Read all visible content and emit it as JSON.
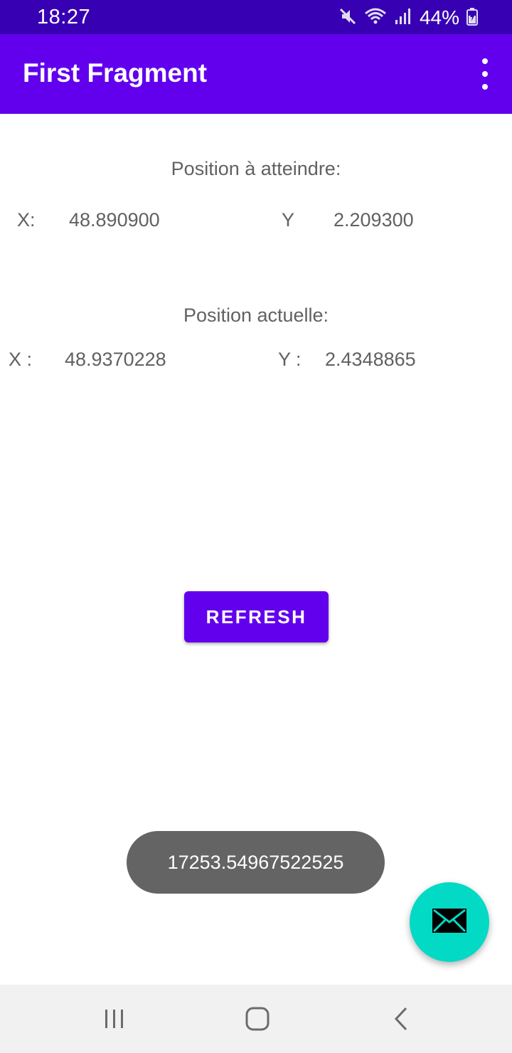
{
  "status_bar": {
    "time": "18:27",
    "battery_text": "44%",
    "icons": [
      "mute-icon",
      "wifi-icon",
      "signal-icon",
      "battery-charging-icon"
    ]
  },
  "app_bar": {
    "title": "First Fragment",
    "menu_icon": "more-vert-icon"
  },
  "target_position": {
    "title": "Position à atteindre:",
    "x_label": "X:",
    "x_value": "48.890900",
    "y_label": "Y",
    "y_value": "2.209300"
  },
  "current_position": {
    "title": "Position actuelle:",
    "x_label": "X :",
    "x_value": "48.9370228",
    "y_label": "Y :",
    "y_value": "2.4348865"
  },
  "refresh_button": {
    "label": "REFRESH"
  },
  "toast": {
    "text": "17253.54967522525"
  },
  "fab": {
    "icon": "email-icon"
  },
  "nav_bar": {
    "icons": [
      "recent-apps-icon",
      "home-icon",
      "back-icon"
    ]
  },
  "colors": {
    "status_bar": "#3700b3",
    "app_bar": "#6200ee",
    "button": "#6200ee",
    "fab": "#03dac5",
    "toast": "#646464"
  }
}
